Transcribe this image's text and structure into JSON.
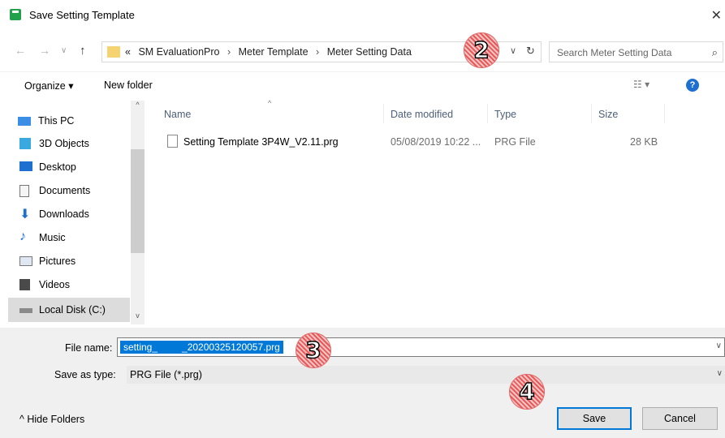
{
  "window": {
    "title": "Save Setting Template",
    "close_glyph": "✕"
  },
  "nav": {
    "back_glyph": "←",
    "forward_glyph": "→",
    "recent_glyph": "∨",
    "up_glyph": "↑",
    "crumbs": [
      "«",
      "SM EvaluationPro",
      "Meter Template",
      "Meter Setting Data"
    ],
    "separator": "›",
    "dropdown_glyph": "∨",
    "refresh_glyph": "↻"
  },
  "search": {
    "placeholder": "Search Meter Setting Data",
    "icon_glyph": "⌕"
  },
  "toolbar": {
    "organize_label": "Organize ▾",
    "new_folder_label": "New folder",
    "view_glyph": "☷ ▾",
    "help_glyph": "?"
  },
  "sidebar": {
    "items": [
      {
        "label": "This PC",
        "icon": "computer-icon"
      },
      {
        "label": "3D Objects",
        "icon": "cube-icon"
      },
      {
        "label": "Desktop",
        "icon": "desktop-icon"
      },
      {
        "label": "Documents",
        "icon": "documents-icon"
      },
      {
        "label": "Downloads",
        "icon": "downloads-icon"
      },
      {
        "label": "Music",
        "icon": "music-icon"
      },
      {
        "label": "Pictures",
        "icon": "pictures-icon"
      },
      {
        "label": "Videos",
        "icon": "videos-icon"
      },
      {
        "label": "Local Disk (C:)",
        "icon": "drive-icon",
        "selected": true
      }
    ],
    "scroll_up": "^",
    "scroll_down": "v"
  },
  "columns": {
    "name": "Name",
    "date": "Date modified",
    "type": "Type",
    "size": "Size",
    "sort_glyph": "^"
  },
  "files": [
    {
      "name": "Setting Template 3P4W_V2.11.prg",
      "date": "05/08/2019 10:22 ...",
      "type": "PRG File",
      "size": "28 KB"
    }
  ],
  "form": {
    "file_name_label": "File name:",
    "file_name_value": "setting_         _20200325120057.prg",
    "save_type_label": "Save as type:",
    "save_type_value": "PRG File (*.prg)",
    "dropdown_glyph": "∨"
  },
  "footer": {
    "hide_folders_label": "^  Hide Folders",
    "save_label": "Save",
    "cancel_label": "Cancel"
  },
  "markers": [
    "2",
    "3",
    "4"
  ],
  "colors": {
    "accent": "#0078d7",
    "marker": "#e85a5a",
    "folder": "#f5d370",
    "app_icon": "#23a04a"
  }
}
